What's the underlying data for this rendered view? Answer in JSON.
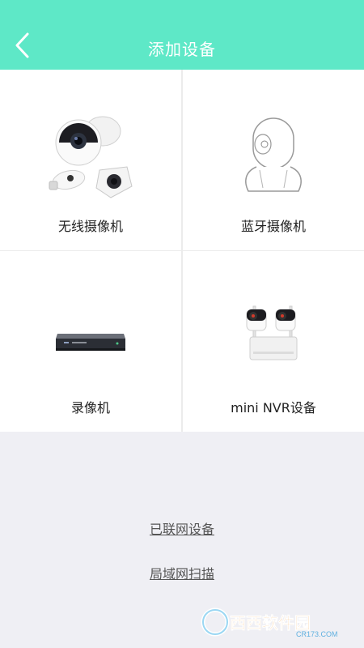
{
  "header": {
    "title": "添加设备",
    "back_icon": "chevron-left-icon",
    "color": "#5ee8c7"
  },
  "devices": [
    {
      "label": "无线摄像机",
      "icon": "wireless-camera-icon"
    },
    {
      "label": "蓝牙摄像机",
      "icon": "bluetooth-camera-icon"
    },
    {
      "label": "录像机",
      "icon": "video-recorder-icon"
    },
    {
      "label": "mini NVR设备",
      "icon": "mini-nvr-icon"
    }
  ],
  "links": {
    "connected": "已联网设备",
    "lan_scan": "局域网扫描"
  },
  "watermark": {
    "brand": "西西软件园",
    "site": "CR173.COM"
  }
}
